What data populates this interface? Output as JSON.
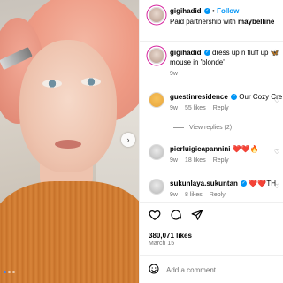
{
  "post": {
    "username": "gigihadid",
    "follow_label": "Follow",
    "partnership_prefix": "Paid partnership with",
    "partner": "maybelline",
    "dot": "•"
  },
  "caption": {
    "username": "gigihadid",
    "text": "dress up n fluff up 🦋 mouse in 'blonde'",
    "time": "9w"
  },
  "comments": [
    {
      "username": "guestinresidence",
      "text": "Our Cozy Cre",
      "time": "9w",
      "likes": "55 likes",
      "reply": "Reply",
      "verified": true
    },
    {
      "username": "pierluigicapannini",
      "text": "❤️❤️🔥",
      "time": "9w",
      "likes": "18 likes",
      "reply": "Reply",
      "verified": false
    },
    {
      "username": "sukunlaya.sukuntan",
      "text": "❤️❤️TH",
      "time": "9w",
      "likes": "8 likes",
      "reply": "Reply",
      "verified": true
    }
  ],
  "view_replies": "View replies (2)",
  "likes_count": "380,071 likes",
  "date": "March 15",
  "comment_placeholder": "Add a comment...",
  "colors": {
    "accent": "#0095f6",
    "muted": "#737373",
    "heart": "#e0245e"
  }
}
